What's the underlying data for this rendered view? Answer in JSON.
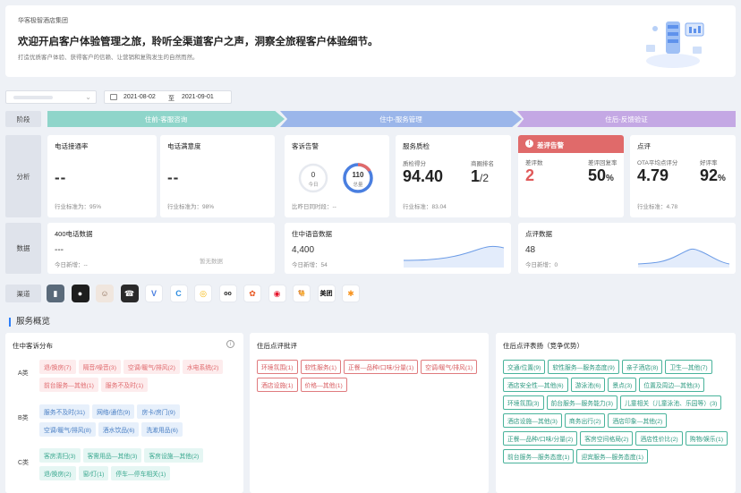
{
  "banner": {
    "org": "华客极智酒店集团",
    "headline": "欢迎开启客户体验管理之旅，聆听全渠道客户之声，洞察全旅程客户体验细节。",
    "sub": "打造优质客户体验、获得客户的信赖、让营销和复购发生的自然而然。"
  },
  "filters": {
    "date_from": "2021-08-02",
    "date_sep": "至",
    "date_to": "2021-09-01"
  },
  "rows": {
    "stage": "阶段",
    "analysis": "分析",
    "data": "数据",
    "channel": "渠道"
  },
  "stages": [
    "住前-客服咨询",
    "住中-服务管理",
    "住后-反馈验证"
  ],
  "cards": {
    "phone_rate": {
      "title": "电话接通率",
      "value": "--",
      "std": "行业标准为：95%"
    },
    "phone_satis": {
      "title": "电话满意度",
      "value": "--",
      "std": "行业标准为：98%"
    },
    "complaint": {
      "title": "客诉告警",
      "today_val": "0",
      "today_label": "今日",
      "total_val": "110",
      "total_label": "总量",
      "compare": "比昨日同时段：--"
    },
    "quality": {
      "title": "服务质检",
      "score_label": "质检得分",
      "score": "94.40",
      "rank_label": "商圈排名",
      "rank": "1",
      "rank_total": "/2",
      "std": "行业标准：83.04"
    },
    "bad_alert": {
      "title": "差评告警",
      "count_label": "差评数",
      "count": "2",
      "reply_label": "差评回复率",
      "reply": "50",
      "reply_unit": "%"
    },
    "review": {
      "title": "点评",
      "ota_label": "OTA平均点评分",
      "ota": "4.79",
      "good_label": "好评率",
      "good": "92",
      "good_unit": "%",
      "std": "行业标准：4.78"
    },
    "phone400": {
      "title": "400电话数据",
      "value": "---",
      "empty": "暂无数据",
      "new": "今日新增：--"
    },
    "voice": {
      "title": "住中语音数据",
      "value": "4,400",
      "new": "今日新增：54"
    },
    "reviewdata": {
      "title": "点评数据",
      "value": "48",
      "new": "今日新增：0"
    }
  },
  "channel_icons": [
    {
      "icon": "phone-app-icon",
      "color": "#3b3b3b",
      "glyph": "▮"
    },
    {
      "icon": "speaker-icon",
      "color": "#222222",
      "glyph": "●"
    },
    {
      "icon": "agent-avatar-icon",
      "color": "#c9a58a",
      "glyph": "☺"
    },
    {
      "icon": "desk-phone-icon",
      "color": "#333333",
      "glyph": "☎"
    },
    {
      "icon": "feizhu-icon",
      "color": "#ffffff",
      "glyph": "V"
    },
    {
      "icon": "tongcheng-icon",
      "color": "#ffffff",
      "glyph": "C"
    },
    {
      "icon": "meituan-icon",
      "color": "#ffffff",
      "glyph": "◎"
    },
    {
      "icon": "tripadvisor-icon",
      "color": "#ffffff",
      "glyph": "oo"
    },
    {
      "icon": "dianping-icon",
      "color": "#ffffff",
      "glyph": "✿"
    },
    {
      "icon": "weibo-icon",
      "color": "#ffffff",
      "glyph": "◉"
    },
    {
      "icon": "qunar-icon",
      "color": "#ffffff",
      "glyph": "🐫"
    },
    {
      "icon": "meituan-text-icon",
      "color": "#ffffff",
      "glyph": "美团"
    },
    {
      "icon": "person-icon",
      "color": "#ffffff",
      "glyph": "✱"
    }
  ],
  "overview": {
    "title": "服务概览",
    "complaint_panel": {
      "title": "住中客诉分布",
      "cats": [
        "A类",
        "B类",
        "C类"
      ],
      "A": [
        "退/换房(7)",
        "隔音/噪音(3)",
        "空调/暖气/排风(2)",
        "水电系统(2)",
        "前台服务—其他(1)",
        "服务不及时(1)"
      ],
      "B": [
        "服务不及时(31)",
        "网络/通信(9)",
        "房卡/房门(9)",
        "空调/暖气/排风(8)",
        "酒水饮品(6)",
        "洗漱用品(6)"
      ],
      "C": [
        "客房清扫(3)",
        "客需用品—其他(3)",
        "客房设施—其他(2)",
        "退/换房(2)",
        "窗/灯(1)",
        "停车—停车相关(1)"
      ]
    },
    "bad_panel": {
      "title": "住后点评批评",
      "tags": [
        "环境氛围(1)",
        "软性服务(1)",
        "正餐—品种/口味/分量(1)",
        "空调/暖气/排风(1)",
        "酒店设施(1)",
        "价格—其他(1)"
      ]
    },
    "good_panel": {
      "title": "住后点评表扬（竞争优势）",
      "tags": [
        "交通/位置(9)",
        "软性服务—服务态度(9)",
        "亲子酒店(8)",
        "卫生—其他(7)",
        "酒店安全性—其他(6)",
        "游泳池(6)",
        "景点(3)",
        "位置及周边—其他(3)",
        "环境氛围(3)",
        "前台服务—服务能力(3)",
        "儿童相关（儿童泳池、乐园等）(3)",
        "酒店设施—其他(3)",
        "商务出行(2)",
        "酒店印象—其他(2)",
        "正餐—品种/口味/分量(2)",
        "客房空间格局(2)",
        "酒店性价比(2)",
        "购物/娱乐(1)",
        "前台服务—服务态度(1)",
        "迎宾服务—服务态度(1)"
      ]
    }
  },
  "colors": {
    "accent": "#2d7ff9",
    "alert": "#e06a6a",
    "stage1": "#8fd5ca",
    "stage2": "#9bb6ea",
    "stage3": "#c4a8e4"
  }
}
